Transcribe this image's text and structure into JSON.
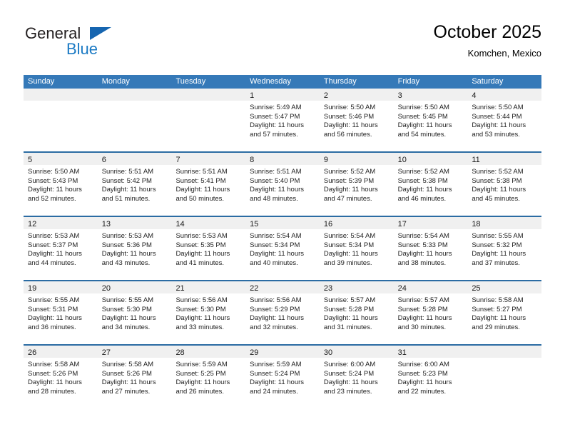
{
  "brand": {
    "name_top": "General",
    "name_bottom": "Blue",
    "triangle_color": "#1665b0",
    "blue_color": "#1b7ac4"
  },
  "header": {
    "title": "October 2025",
    "subtitle": "Komchen, Mexico"
  },
  "colors": {
    "header_blue": "#3579b8",
    "row_divider": "#2b6ca3",
    "day_strip": "#f0f0f0"
  },
  "weekdays": [
    "Sunday",
    "Monday",
    "Tuesday",
    "Wednesday",
    "Thursday",
    "Friday",
    "Saturday"
  ],
  "weeks": [
    [
      {
        "empty": true
      },
      {
        "empty": true
      },
      {
        "empty": true
      },
      {
        "day": "1",
        "sunrise": "Sunrise: 5:49 AM",
        "sunset": "Sunset: 5:47 PM",
        "daylight1": "Daylight: 11 hours",
        "daylight2": "and 57 minutes."
      },
      {
        "day": "2",
        "sunrise": "Sunrise: 5:50 AM",
        "sunset": "Sunset: 5:46 PM",
        "daylight1": "Daylight: 11 hours",
        "daylight2": "and 56 minutes."
      },
      {
        "day": "3",
        "sunrise": "Sunrise: 5:50 AM",
        "sunset": "Sunset: 5:45 PM",
        "daylight1": "Daylight: 11 hours",
        "daylight2": "and 54 minutes."
      },
      {
        "day": "4",
        "sunrise": "Sunrise: 5:50 AM",
        "sunset": "Sunset: 5:44 PM",
        "daylight1": "Daylight: 11 hours",
        "daylight2": "and 53 minutes."
      }
    ],
    [
      {
        "day": "5",
        "sunrise": "Sunrise: 5:50 AM",
        "sunset": "Sunset: 5:43 PM",
        "daylight1": "Daylight: 11 hours",
        "daylight2": "and 52 minutes."
      },
      {
        "day": "6",
        "sunrise": "Sunrise: 5:51 AM",
        "sunset": "Sunset: 5:42 PM",
        "daylight1": "Daylight: 11 hours",
        "daylight2": "and 51 minutes."
      },
      {
        "day": "7",
        "sunrise": "Sunrise: 5:51 AM",
        "sunset": "Sunset: 5:41 PM",
        "daylight1": "Daylight: 11 hours",
        "daylight2": "and 50 minutes."
      },
      {
        "day": "8",
        "sunrise": "Sunrise: 5:51 AM",
        "sunset": "Sunset: 5:40 PM",
        "daylight1": "Daylight: 11 hours",
        "daylight2": "and 48 minutes."
      },
      {
        "day": "9",
        "sunrise": "Sunrise: 5:52 AM",
        "sunset": "Sunset: 5:39 PM",
        "daylight1": "Daylight: 11 hours",
        "daylight2": "and 47 minutes."
      },
      {
        "day": "10",
        "sunrise": "Sunrise: 5:52 AM",
        "sunset": "Sunset: 5:38 PM",
        "daylight1": "Daylight: 11 hours",
        "daylight2": "and 46 minutes."
      },
      {
        "day": "11",
        "sunrise": "Sunrise: 5:52 AM",
        "sunset": "Sunset: 5:38 PM",
        "daylight1": "Daylight: 11 hours",
        "daylight2": "and 45 minutes."
      }
    ],
    [
      {
        "day": "12",
        "sunrise": "Sunrise: 5:53 AM",
        "sunset": "Sunset: 5:37 PM",
        "daylight1": "Daylight: 11 hours",
        "daylight2": "and 44 minutes."
      },
      {
        "day": "13",
        "sunrise": "Sunrise: 5:53 AM",
        "sunset": "Sunset: 5:36 PM",
        "daylight1": "Daylight: 11 hours",
        "daylight2": "and 43 minutes."
      },
      {
        "day": "14",
        "sunrise": "Sunrise: 5:53 AM",
        "sunset": "Sunset: 5:35 PM",
        "daylight1": "Daylight: 11 hours",
        "daylight2": "and 41 minutes."
      },
      {
        "day": "15",
        "sunrise": "Sunrise: 5:54 AM",
        "sunset": "Sunset: 5:34 PM",
        "daylight1": "Daylight: 11 hours",
        "daylight2": "and 40 minutes."
      },
      {
        "day": "16",
        "sunrise": "Sunrise: 5:54 AM",
        "sunset": "Sunset: 5:34 PM",
        "daylight1": "Daylight: 11 hours",
        "daylight2": "and 39 minutes."
      },
      {
        "day": "17",
        "sunrise": "Sunrise: 5:54 AM",
        "sunset": "Sunset: 5:33 PM",
        "daylight1": "Daylight: 11 hours",
        "daylight2": "and 38 minutes."
      },
      {
        "day": "18",
        "sunrise": "Sunrise: 5:55 AM",
        "sunset": "Sunset: 5:32 PM",
        "daylight1": "Daylight: 11 hours",
        "daylight2": "and 37 minutes."
      }
    ],
    [
      {
        "day": "19",
        "sunrise": "Sunrise: 5:55 AM",
        "sunset": "Sunset: 5:31 PM",
        "daylight1": "Daylight: 11 hours",
        "daylight2": "and 36 minutes."
      },
      {
        "day": "20",
        "sunrise": "Sunrise: 5:55 AM",
        "sunset": "Sunset: 5:30 PM",
        "daylight1": "Daylight: 11 hours",
        "daylight2": "and 34 minutes."
      },
      {
        "day": "21",
        "sunrise": "Sunrise: 5:56 AM",
        "sunset": "Sunset: 5:30 PM",
        "daylight1": "Daylight: 11 hours",
        "daylight2": "and 33 minutes."
      },
      {
        "day": "22",
        "sunrise": "Sunrise: 5:56 AM",
        "sunset": "Sunset: 5:29 PM",
        "daylight1": "Daylight: 11 hours",
        "daylight2": "and 32 minutes."
      },
      {
        "day": "23",
        "sunrise": "Sunrise: 5:57 AM",
        "sunset": "Sunset: 5:28 PM",
        "daylight1": "Daylight: 11 hours",
        "daylight2": "and 31 minutes."
      },
      {
        "day": "24",
        "sunrise": "Sunrise: 5:57 AM",
        "sunset": "Sunset: 5:28 PM",
        "daylight1": "Daylight: 11 hours",
        "daylight2": "and 30 minutes."
      },
      {
        "day": "25",
        "sunrise": "Sunrise: 5:58 AM",
        "sunset": "Sunset: 5:27 PM",
        "daylight1": "Daylight: 11 hours",
        "daylight2": "and 29 minutes."
      }
    ],
    [
      {
        "day": "26",
        "sunrise": "Sunrise: 5:58 AM",
        "sunset": "Sunset: 5:26 PM",
        "daylight1": "Daylight: 11 hours",
        "daylight2": "and 28 minutes."
      },
      {
        "day": "27",
        "sunrise": "Sunrise: 5:58 AM",
        "sunset": "Sunset: 5:26 PM",
        "daylight1": "Daylight: 11 hours",
        "daylight2": "and 27 minutes."
      },
      {
        "day": "28",
        "sunrise": "Sunrise: 5:59 AM",
        "sunset": "Sunset: 5:25 PM",
        "daylight1": "Daylight: 11 hours",
        "daylight2": "and 26 minutes."
      },
      {
        "day": "29",
        "sunrise": "Sunrise: 5:59 AM",
        "sunset": "Sunset: 5:24 PM",
        "daylight1": "Daylight: 11 hours",
        "daylight2": "and 24 minutes."
      },
      {
        "day": "30",
        "sunrise": "Sunrise: 6:00 AM",
        "sunset": "Sunset: 5:24 PM",
        "daylight1": "Daylight: 11 hours",
        "daylight2": "and 23 minutes."
      },
      {
        "day": "31",
        "sunrise": "Sunrise: 6:00 AM",
        "sunset": "Sunset: 5:23 PM",
        "daylight1": "Daylight: 11 hours",
        "daylight2": "and 22 minutes."
      },
      {
        "empty": true
      }
    ]
  ]
}
